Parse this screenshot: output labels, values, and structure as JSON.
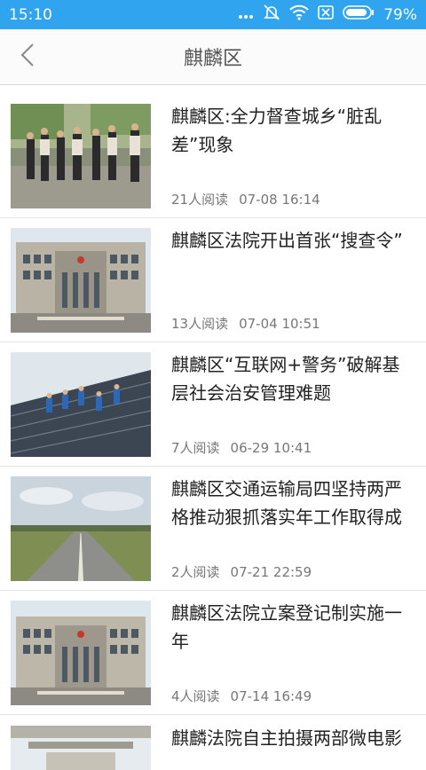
{
  "status_bar": {
    "time": "15:10",
    "battery": "79%",
    "icons": [
      "more-dots-icon",
      "mute-icon",
      "wifi-icon",
      "sim-x-icon",
      "battery-icon"
    ]
  },
  "header": {
    "back_icon": "chevron-left-icon",
    "title": "麒麟区"
  },
  "articles": [
    {
      "title": "麒麟区:全力督查城乡“脏乱差”现象",
      "reads": "21人阅读",
      "date": "07-08 16:14",
      "thumb": "photo-officials-outdoors"
    },
    {
      "title": "麒麟区法院开出首张“搜查令”",
      "reads": "13人阅读",
      "date": "07-04 10:51",
      "thumb": "photo-court-building"
    },
    {
      "title": "麒麟区“互联网+警务”破解基层社会治安管理难题",
      "reads": "7人阅读",
      "date": "06-29 10:41",
      "thumb": "photo-police-figurines-keyboard"
    },
    {
      "title": "麒麟区交通运输局四坚持两严格推动狠抓落实年工作取得成",
      "reads": "2人阅读",
      "date": "07-21 22:59",
      "thumb": "photo-rural-road"
    },
    {
      "title": "麒麟区法院立案登记制实施一年",
      "reads": "4人阅读",
      "date": "07-14 16:49",
      "thumb": "photo-court-building"
    },
    {
      "title": "麒麟法院自主拍摄两部微电影",
      "thumb": "photo-building-top"
    }
  ],
  "colors": {
    "status_bar": "#30a4ee",
    "title": "#555555",
    "headline": "#222222",
    "meta": "#777777"
  }
}
